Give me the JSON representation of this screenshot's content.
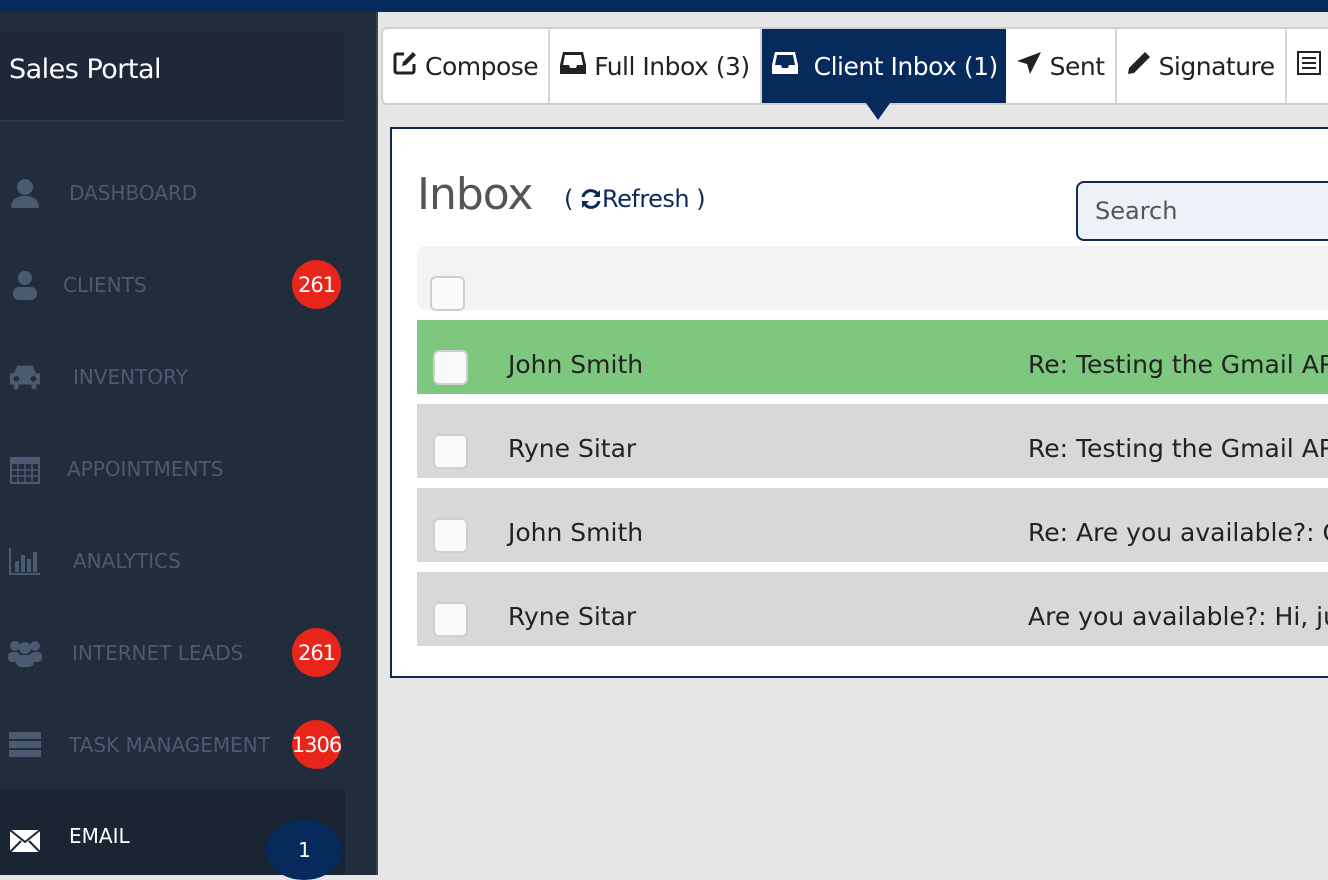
{
  "app": {
    "title": "Sales Portal"
  },
  "colors": {
    "navy": "#062a5c",
    "badge_red": "#e8251a",
    "unread_row": "#7dc87e"
  },
  "sidebar": {
    "items": [
      {
        "label": "DASHBOARD",
        "icon": "user-icon"
      },
      {
        "label": "CLIENTS",
        "icon": "user-icon",
        "badge": "261"
      },
      {
        "label": "INVENTORY",
        "icon": "car-icon"
      },
      {
        "label": "APPOINTMENTS",
        "icon": "calendar-icon"
      },
      {
        "label": "ANALYTICS",
        "icon": "bar-chart-icon"
      },
      {
        "label": "INTERNET LEADS",
        "icon": "users-icon",
        "badge": "261"
      },
      {
        "label": "TASK MANAGEMENT",
        "icon": "tasks-icon",
        "badge": "1306"
      },
      {
        "label": "EMAIL",
        "icon": "envelope-icon",
        "badge": "1",
        "active": true
      }
    ]
  },
  "tabs": [
    {
      "label": "Compose",
      "icon": "edit-icon"
    },
    {
      "label": "Full Inbox (3)",
      "icon": "inbox-icon"
    },
    {
      "label": "Client Inbox (1)",
      "icon": "inbox-icon",
      "active": true
    },
    {
      "label": "Sent",
      "icon": "send-icon"
    },
    {
      "label": "Signature",
      "icon": "pencil-icon"
    },
    {
      "label": "",
      "icon": "list-icon"
    }
  ],
  "inbox": {
    "title": "Inbox",
    "refresh_open": "( ",
    "refresh": "Refresh",
    "refresh_close": " )",
    "search_placeholder": "Search",
    "rows": [
      {
        "from": "John Smith",
        "subject": "Re: Testing the Gmail API",
        "unread": true
      },
      {
        "from": "Ryne Sitar",
        "subject": "Re: Testing the Gmail API"
      },
      {
        "from": "John Smith",
        "subject": "Re: Are you available?: Gr"
      },
      {
        "from": "Ryne Sitar",
        "subject": "Are you available?: Hi, jus"
      }
    ]
  }
}
